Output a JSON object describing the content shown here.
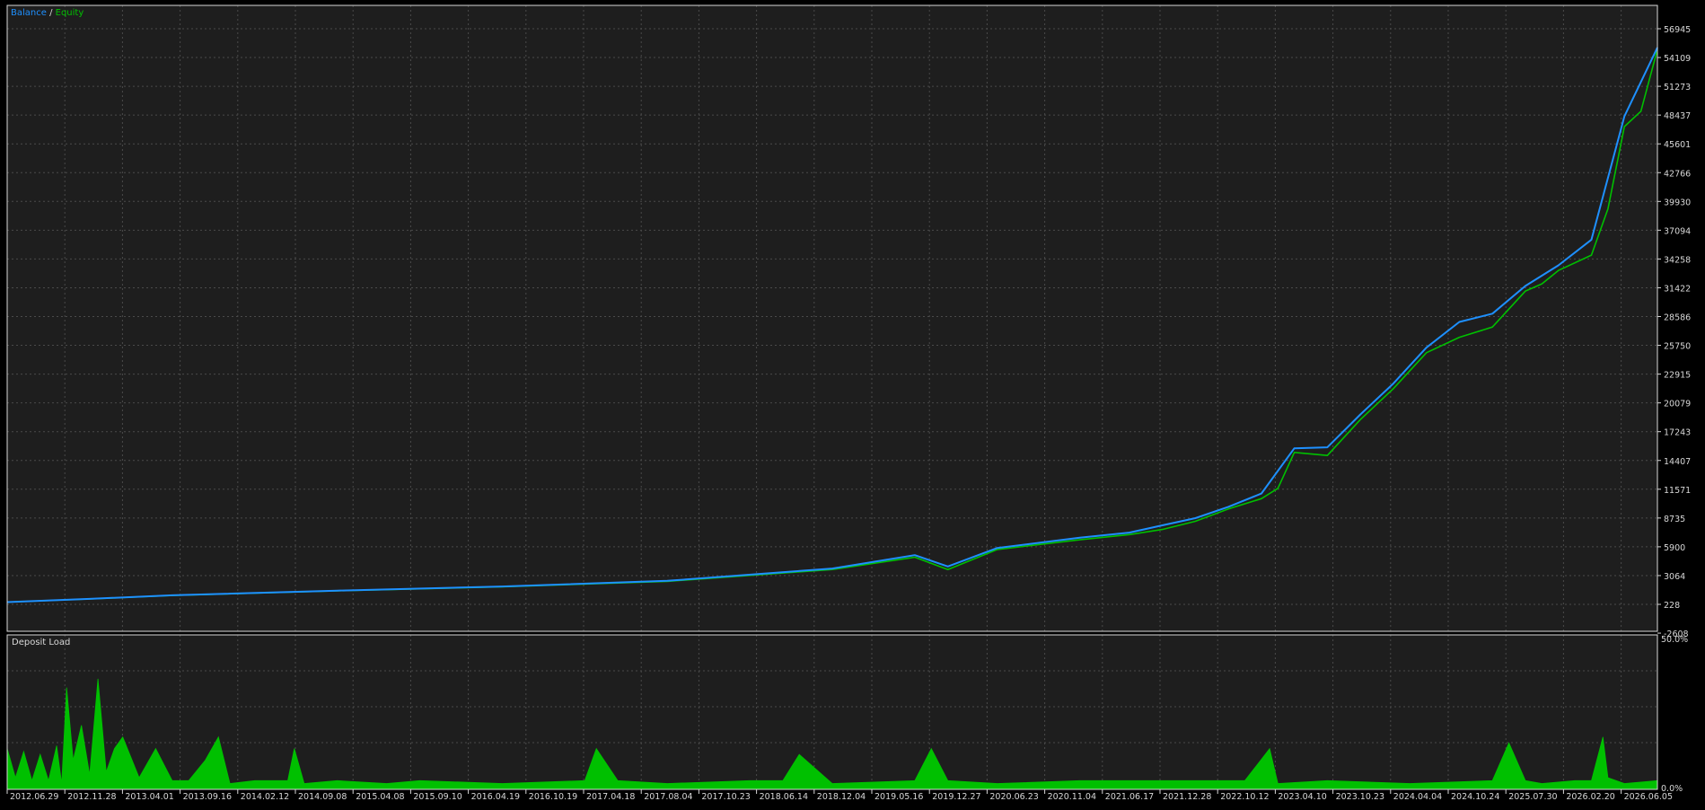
{
  "colors": {
    "background": "#000000",
    "plot_background": "#1e1e1e",
    "grid": "#4a4a4a",
    "frame": "#d8d8d8",
    "text": "#d8d8d8",
    "balance": "#1e90ff",
    "equity": "#00c000",
    "deposit_load": "#00c000"
  },
  "legend": {
    "balance_label": "Balance",
    "separator": " / ",
    "equity_label": "Equity"
  },
  "chart_data": [
    {
      "type": "line",
      "series": [
        {
          "name": "Balance",
          "x": [
            0,
            5,
            10,
            20,
            30,
            40,
            50,
            55,
            57,
            60,
            65,
            68,
            70,
            72,
            74,
            76,
            78,
            80,
            82,
            84,
            86,
            88,
            90,
            92,
            94,
            96,
            98,
            100
          ],
          "values": [
            228,
            550,
            900,
            1350,
            1750,
            2300,
            3500,
            4800,
            3700,
            5500,
            6500,
            7000,
            7700,
            8400,
            9500,
            10800,
            15200,
            15300,
            18500,
            21500,
            25000,
            27500,
            28300,
            31000,
            33000,
            35500,
            47500,
            54200
          ]
        },
        {
          "name": "Equity",
          "x": [
            0,
            5,
            10,
            20,
            30,
            40,
            50,
            55,
            57,
            60,
            65,
            68,
            70,
            72,
            74,
            76,
            77,
            78,
            80,
            82,
            84,
            86,
            88,
            90,
            92,
            93,
            94,
            96,
            97,
            98,
            99,
            100
          ],
          "values": [
            228,
            540,
            880,
            1330,
            1720,
            2250,
            3400,
            4600,
            3400,
            5350,
            6300,
            6800,
            7300,
            8100,
            9300,
            10300,
            11300,
            14800,
            14500,
            18000,
            21000,
            24500,
            26000,
            27000,
            30500,
            31200,
            32500,
            34000,
            38500,
            46500,
            48000,
            54000
          ]
        }
      ],
      "x_tick_labels": [
        "2012.06.29",
        "2012.11.28",
        "2013.04.01",
        "2013.09.16",
        "2014.02.12",
        "2014.09.08",
        "2015.04.08",
        "2015.09.10",
        "2016.04.19",
        "2016.10.19",
        "2017.04.18",
        "2017.08.04",
        "2017.10.23",
        "2018.06.14",
        "2018.12.04",
        "2019.05.16",
        "2019.12.27",
        "2020.06.23",
        "2020.11.04",
        "2021.06.17",
        "2021.12.28",
        "2022.10.12",
        "2023.04.10",
        "2023.10.23",
        "2024.04.04",
        "2024.10.24",
        "2025.07.30",
        "2026.02.20",
        "2026.06.05"
      ],
      "y_tick_labels": [
        "56945",
        "54109",
        "51273",
        "48437",
        "45601",
        "42766",
        "39930",
        "37094",
        "34258",
        "31422",
        "28586",
        "25750",
        "22915",
        "20079",
        "17243",
        "14407",
        "11571",
        "8735",
        "5900",
        "3064",
        "228",
        "-2608"
      ],
      "ylim": [
        -2608,
        58300
      ],
      "grid": true,
      "legend_position": "top-left"
    },
    {
      "type": "area",
      "title": "Deposit Load",
      "series": [
        {
          "name": "Deposit Load",
          "x": [
            0,
            0.5,
            1,
            1.5,
            2,
            2.5,
            3,
            3.3,
            3.6,
            4,
            4.5,
            5,
            5.5,
            6,
            6.5,
            7,
            8,
            9,
            10,
            11,
            12,
            12.8,
            13.5,
            15,
            17,
            17.4,
            18,
            20,
            23,
            25,
            30,
            35,
            35.7,
            37,
            40,
            45,
            47,
            48,
            50,
            55,
            56,
            57,
            60,
            65,
            70,
            75,
            76.5,
            77,
            80,
            85,
            90,
            91,
            92,
            93,
            95,
            96,
            96.7,
            97,
            98,
            100
          ],
          "values": [
            14,
            4,
            13,
            3,
            12,
            3,
            15,
            2,
            35,
            10,
            22,
            5,
            38,
            6,
            14,
            18,
            4,
            14,
            3,
            3,
            10,
            18,
            2,
            3,
            3,
            14,
            2,
            3,
            2,
            3,
            2,
            3,
            14,
            3,
            2,
            3,
            3,
            12,
            2,
            3,
            14,
            3,
            2,
            3,
            3,
            3,
            14,
            2,
            3,
            2,
            3,
            16,
            3,
            2,
            3,
            3,
            18,
            4,
            2,
            3
          ]
        }
      ],
      "y_tick_labels": [
        "50.0%",
        "0.0%"
      ],
      "ylim": [
        0,
        50
      ],
      "grid": true
    }
  ]
}
